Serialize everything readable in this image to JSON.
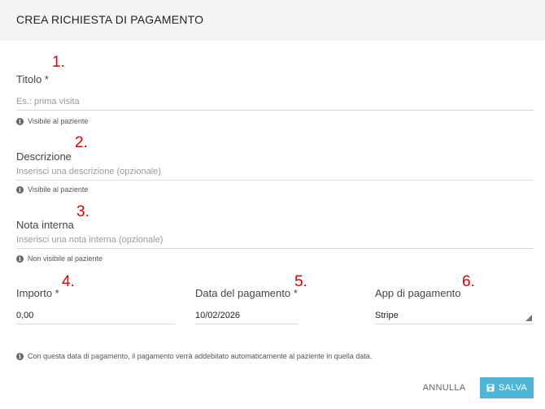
{
  "dialog": {
    "title": "CREA RICHIESTA DI PAGAMENTO"
  },
  "annotations": [
    "1.",
    "2.",
    "3.",
    "4.",
    "5.",
    "6."
  ],
  "form": {
    "titolo": {
      "label": "Titolo *",
      "placeholder": "Es.: prima visita",
      "value": "",
      "hint": "Visibile al paziente"
    },
    "descrizione": {
      "label": "Descrizione",
      "placeholder": "Inserisci una descrizione (opzionale)",
      "value": "",
      "hint": "Visibile al paziente"
    },
    "nota_interna": {
      "label": "Nota interna",
      "placeholder": "Inserisci una nota interna (opzionale)",
      "value": "",
      "hint": "Non visibile al paziente"
    },
    "importo": {
      "label": "Importo *",
      "value": "0,00"
    },
    "data_pagamento": {
      "label": "Data del pagamento *",
      "value": "10/02/2026"
    },
    "app_pagamento": {
      "label": "App di pagamento",
      "value": "Stripe"
    },
    "footer_hint": "Con questa data di pagamento, il pagamento verrà addebitato automaticamente al paziente in quella data."
  },
  "actions": {
    "cancel_label": "ANNULLA",
    "save_label": "SALVA"
  },
  "icons": {
    "info": "info-circle-icon",
    "save": "floppy-disk-icon",
    "dropdown": "dropdown-triangle-icon"
  },
  "colors": {
    "annotation": "#e00000",
    "primary_button": "#4fb6d8",
    "header_bg": "#f5f5f5"
  }
}
